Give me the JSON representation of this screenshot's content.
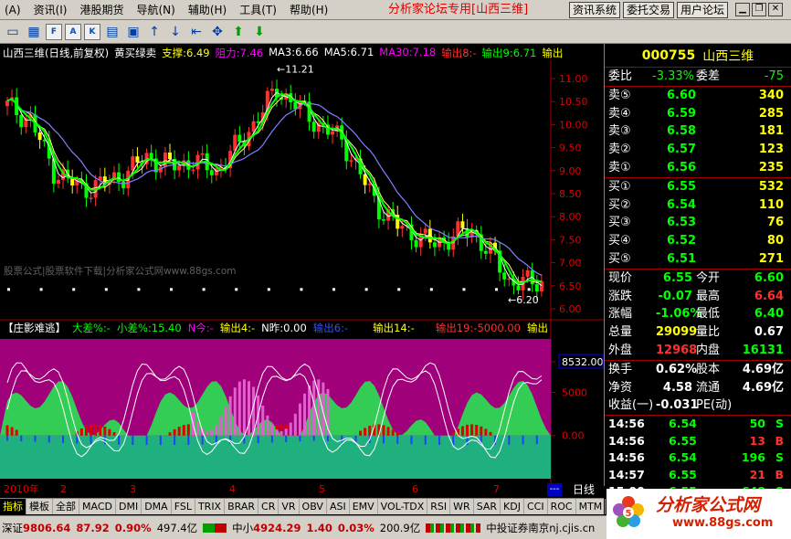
{
  "menu": {
    "items": [
      "(A)",
      "资讯(I)",
      "港股期货",
      "导航(N)",
      "辅助(H)",
      "工具(T)",
      "帮助(H)"
    ],
    "forum_title": "分析家论坛专用[山西三维]",
    "buttons": [
      "资讯系统",
      "委托交易",
      "用户论坛"
    ]
  },
  "chart": {
    "info_line": [
      {
        "text": "山西三维(日线,前复权)",
        "color": "#ffffff"
      },
      {
        "text": "黄买绿卖",
        "color": "#ffffff"
      },
      {
        "text": "支撑:6.49",
        "color": "#ffff00"
      },
      {
        "text": "阻力:7.46",
        "color": "#ff00ff"
      },
      {
        "text": "MA3:6.66",
        "color": "#ffffff"
      },
      {
        "text": "MA5:6.71",
        "color": "#ffffff"
      },
      {
        "text": "MA30:7.18",
        "color": "#ff00ff"
      },
      {
        "text": "输出8:-",
        "color": "#ff3030"
      },
      {
        "text": "输出9:6.71",
        "color": "#00ff00"
      },
      {
        "text": "输出",
        "color": "#ffff00"
      }
    ],
    "price_axis": [
      "11.00",
      "10.50",
      "10.00",
      "9.50",
      "9.00",
      "8.50",
      "8.00",
      "7.50",
      "7.00",
      "6.50",
      "6.00"
    ],
    "high_label": "11.21",
    "low_label": "6.20",
    "watermark": "股票公式|股票软件下载|分析家公式网www.88gs.com",
    "indicator_line": [
      {
        "text": "【庄影难逃】",
        "color": "#ffffff"
      },
      {
        "text": "大差%:-",
        "color": "#00ff00"
      },
      {
        "text": "小差%:15.40",
        "color": "#00ff00"
      },
      {
        "text": "N今:-",
        "color": "#ff00ff"
      },
      {
        "text": "输出4:-",
        "color": "#ffff00"
      },
      {
        "text": "N昨:0.00",
        "color": "#ffffff"
      },
      {
        "text": "输出6:-",
        "color": "#0000ff"
      },
      {
        "text": "输出14:-",
        "color": "#ffff00"
      },
      {
        "text": "输出19:-5000.00",
        "color": "#ff3030"
      },
      {
        "text": "输出",
        "color": "#ffff00"
      }
    ],
    "ind_axis": [
      "8532.00",
      "5000",
      "0.00"
    ],
    "date_labels": [
      "2010年",
      "2",
      "3",
      "4",
      "5",
      "6",
      "7"
    ],
    "period_label": "日线",
    "dashes_label": "---"
  },
  "quote": {
    "code": "000755",
    "name": "山西三维",
    "weibi_label": "委比",
    "weibi": "-3.33%",
    "weicha_label": "委差",
    "weicha": "-75",
    "sells": [
      {
        "label": "卖⑤",
        "price": "6.60",
        "vol": "340"
      },
      {
        "label": "卖④",
        "price": "6.59",
        "vol": "285"
      },
      {
        "label": "卖③",
        "price": "6.58",
        "vol": "181"
      },
      {
        "label": "卖②",
        "price": "6.57",
        "vol": "123"
      },
      {
        "label": "卖①",
        "price": "6.56",
        "vol": "235"
      }
    ],
    "buys": [
      {
        "label": "买①",
        "price": "6.55",
        "vol": "532"
      },
      {
        "label": "买②",
        "price": "6.54",
        "vol": "110"
      },
      {
        "label": "买③",
        "price": "6.53",
        "vol": "76"
      },
      {
        "label": "买④",
        "price": "6.52",
        "vol": "80"
      },
      {
        "label": "买⑤",
        "price": "6.51",
        "vol": "271"
      }
    ],
    "stats": [
      {
        "l1": "现价",
        "v1": "6.55",
        "c1": "#00ff00",
        "l2": "今开",
        "v2": "6.60",
        "c2": "#00ff00"
      },
      {
        "l1": "涨跌",
        "v1": "-0.07",
        "c1": "#00ff00",
        "l2": "最高",
        "v2": "6.64",
        "c2": "#ff3030"
      },
      {
        "l1": "涨幅",
        "v1": "-1.06%",
        "c1": "#00ff00",
        "l2": "最低",
        "v2": "6.40",
        "c2": "#00ff00"
      },
      {
        "l1": "总量",
        "v1": "29099",
        "c1": "#ffff00",
        "l2": "量比",
        "v2": "0.67",
        "c2": "#ffffff"
      },
      {
        "l1": "外盘",
        "v1": "12968",
        "c1": "#ff3030",
        "l2": "内盘",
        "v2": "16131",
        "c2": "#00ff00"
      }
    ],
    "stats2": [
      {
        "l1": "换手",
        "v1": "0.62%",
        "l2": "股本",
        "v2": "4.69亿"
      },
      {
        "l1": "净资",
        "v1": "4.58",
        "l2": "流通",
        "v2": "4.69亿"
      },
      {
        "l1": "收益(一)",
        "v1": "-0.031",
        "l2": "PE(动)",
        "v2": ""
      }
    ],
    "ticks": [
      {
        "time": "14:56",
        "price": "6.54",
        "vol": "50",
        "dir": "S"
      },
      {
        "time": "14:56",
        "price": "6.55",
        "vol": "13",
        "dir": "B"
      },
      {
        "time": "14:56",
        "price": "6.54",
        "vol": "196",
        "dir": "S"
      },
      {
        "time": "14:57",
        "price": "6.55",
        "vol": "21",
        "dir": "B"
      },
      {
        "time": "15:00",
        "price": "6.55",
        "vol": "648",
        "dir": "S"
      }
    ]
  },
  "tabs": [
    "指标",
    "模板",
    "全部",
    "MACD",
    "DMI",
    "DMA",
    "FSL",
    "TRIX",
    "BRAR",
    "CR",
    "VR",
    "OBV",
    "ASI",
    "EMV",
    "VOL-TDX",
    "RSI",
    "WR",
    "SAR",
    "KDJ",
    "CCI",
    "ROC",
    "MTM",
    "BOLL"
  ],
  "status": {
    "sz_label": "深证",
    "sz_index": "9806.64",
    "sz_change": "87.92",
    "sz_pct": "0.90%",
    "sz_amount": "497.4亿",
    "zx_label": "中小",
    "zx_index": "4924.29",
    "zx_change": "1.40",
    "zx_pct": "0.03%",
    "zx_amount": "200.9亿",
    "broker": "中投证券南京nj.cjis.cn"
  },
  "logo": {
    "title": "分析家公式网",
    "url": "www.88gs.com"
  },
  "colors": {
    "up": "#ff3030",
    "down": "#00ff00",
    "yellow": "#ffff00",
    "magenta": "#ff00ff",
    "panel_bg": "#a0007a",
    "area_green": "#33cc55",
    "teal": "#20b080"
  },
  "icons": [
    "new-window-icon",
    "grid-icon",
    "f10-icon",
    "abc-icon",
    "k-icon",
    "chart-icon",
    "news-icon",
    "arrow-up-icon",
    "arrow-down-icon",
    "arrow-left-icon",
    "move-icon",
    "up-icon",
    "down-icon"
  ]
}
